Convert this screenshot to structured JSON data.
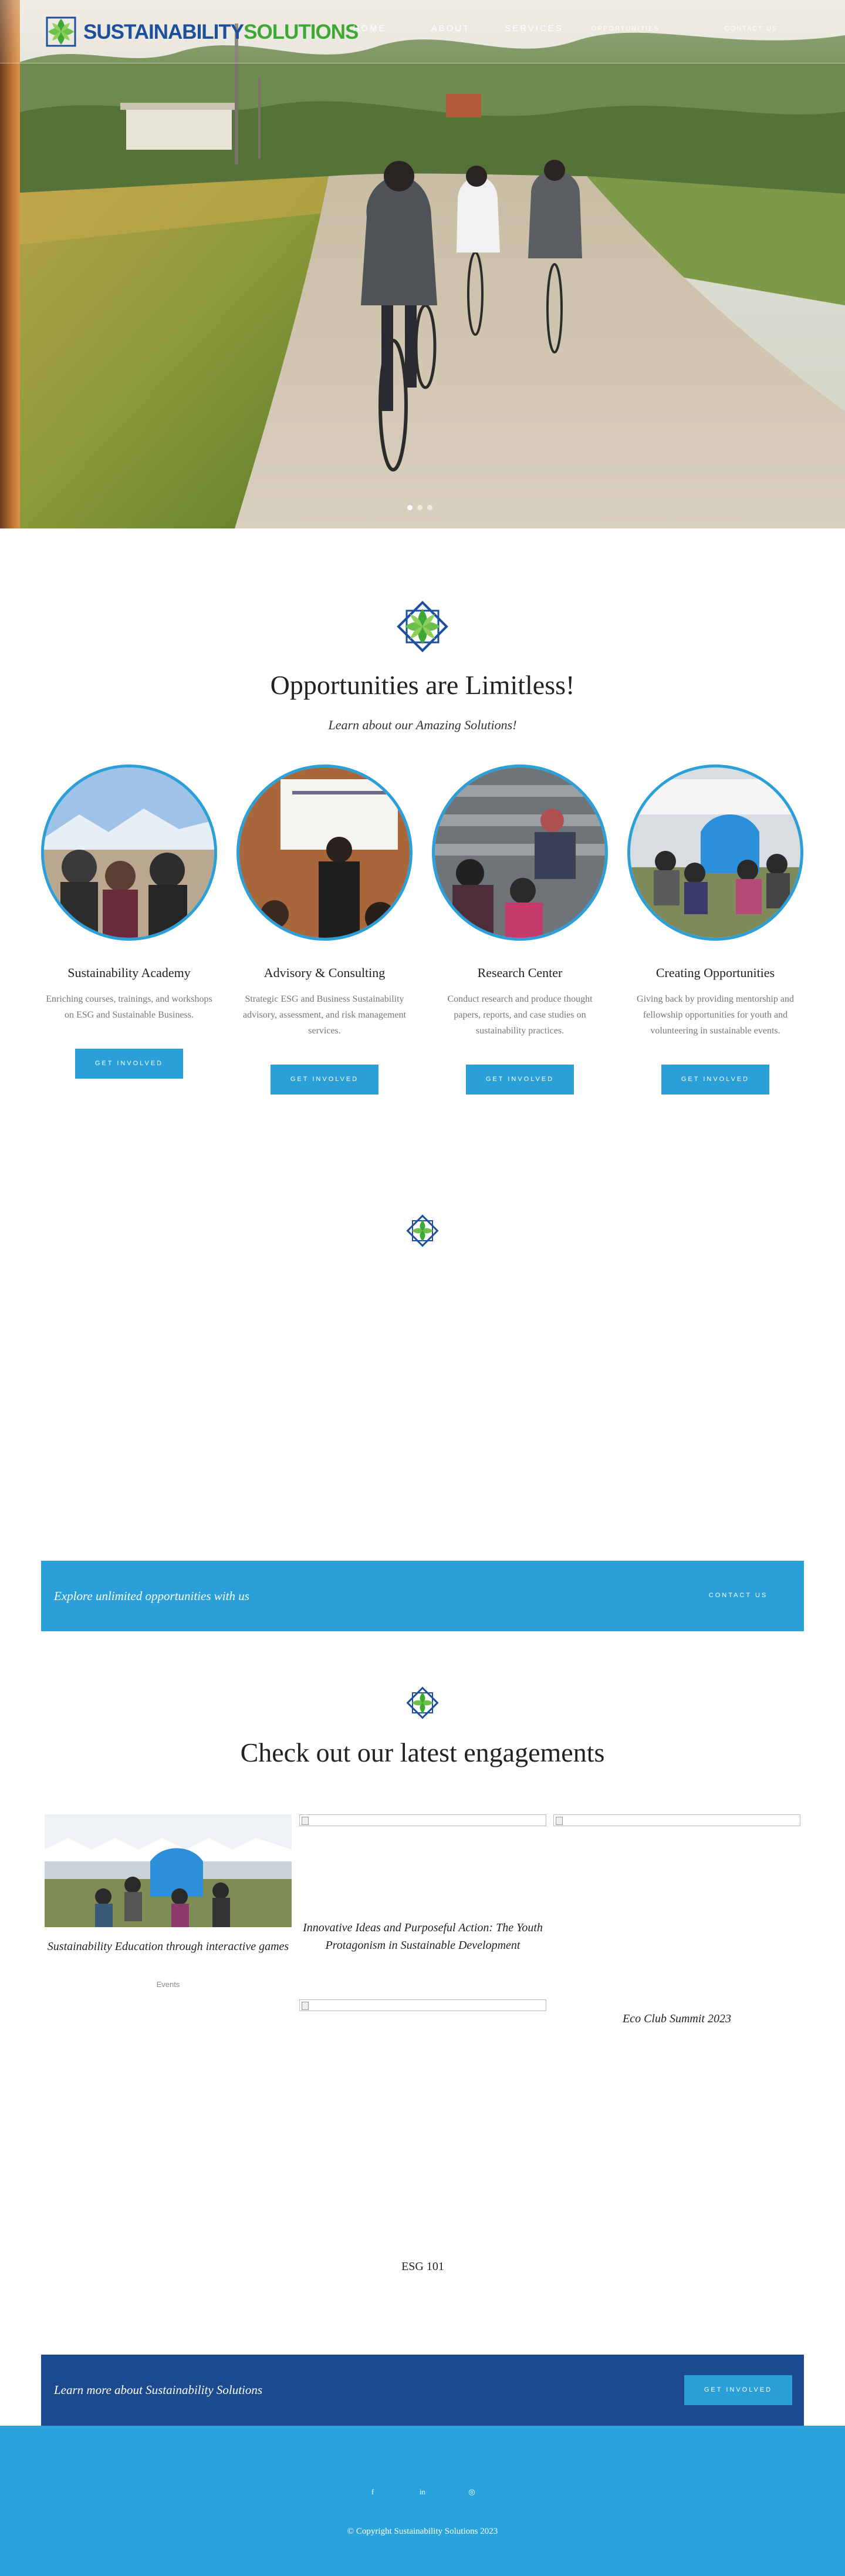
{
  "brand": {
    "name_part1": "SUSTAINABILITY",
    "name_part2": "SOLUTIONS",
    "colors": {
      "blue": "#1d4f9c",
      "green": "#3fa835",
      "accent": "#2a9fd8",
      "navy": "#1c4a8e"
    }
  },
  "nav": {
    "items": [
      {
        "label": "HOME"
      },
      {
        "label": "ABOUT"
      },
      {
        "label": "SERVICES"
      },
      {
        "label": "OPPORTUNITIES"
      },
      {
        "label": "CONTACT US"
      }
    ]
  },
  "hero": {
    "slides": 3,
    "active_slide": 1
  },
  "opportunities": {
    "heading": "Opportunities are Limitless!",
    "subheading": "Learn about our Amazing Solutions!",
    "cards": [
      {
        "title": "Sustainability Academy",
        "text": "Enriching courses, trainings, and workshops on ESG and Sustainable Business.",
        "button": "GET INVOLVED"
      },
      {
        "title": "Advisory & Consulting",
        "text": "Strategic ESG and Business Sustainability advisory, assessment, and risk management services.",
        "button": "GET INVOLVED"
      },
      {
        "title": "Research Center",
        "text": "Conduct research and produce thought papers, reports, and case studies on sustainability practices.",
        "button": "GET INVOLVED"
      },
      {
        "title": "Creating Opportunities",
        "text": "Giving back by providing mentorship and fellowship opportunities for youth and volunteering in sustainable events.",
        "button": "GET INVOLVED"
      }
    ]
  },
  "explore_band": {
    "text": "Explore unlimited opportunities with us",
    "button": "CONTACT US"
  },
  "engagements": {
    "heading": "Check out our latest engagements",
    "items": [
      {
        "title": "Sustainability Education through interactive games",
        "category": "Events"
      },
      {
        "title": "Innovative Ideas and Purposeful Action: The Youth Protagonism in Sustainable Development"
      },
      {
        "title": "Eco Club Summit 2023"
      },
      {
        "title": "ESG 101"
      }
    ]
  },
  "learn_band": {
    "text": "Learn more about Sustainability Solutions",
    "button": "GET INVOLVED"
  },
  "footer": {
    "social_icons": [
      "facebook-icon",
      "linkedin-icon",
      "instagram-icon"
    ],
    "copyright": "© Copyright Sustainability Solutions 2023"
  }
}
